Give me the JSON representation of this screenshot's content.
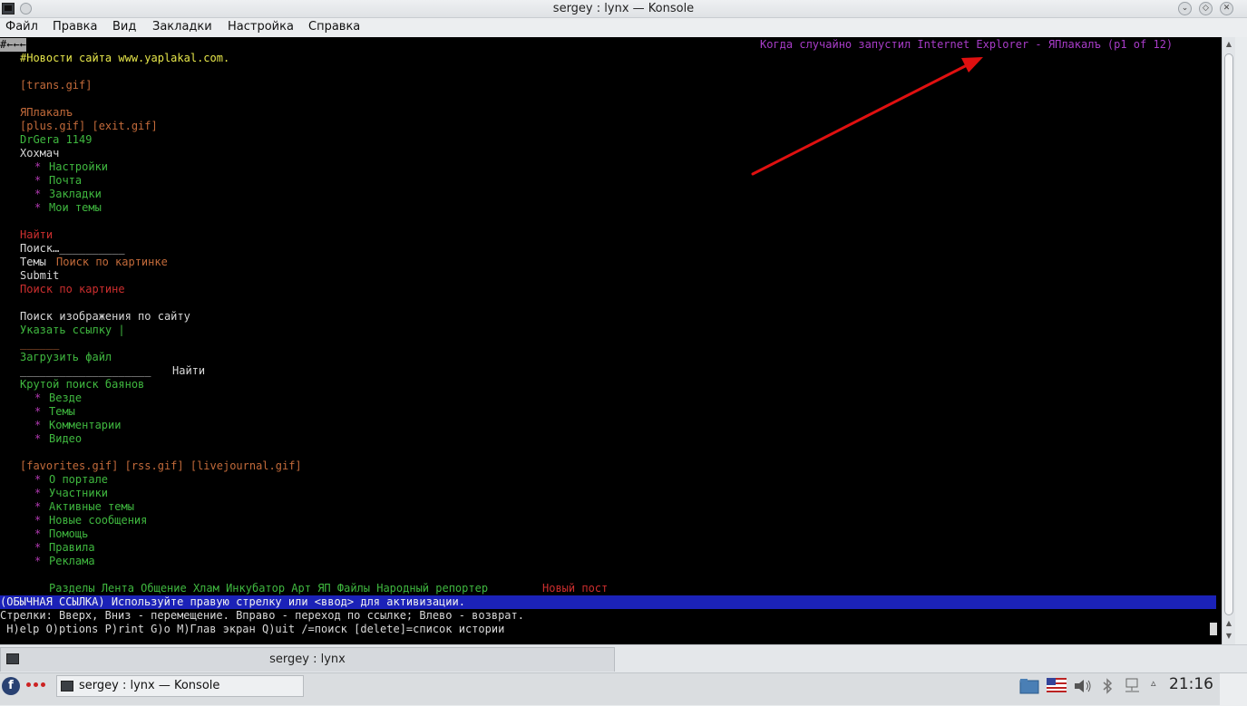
{
  "window": {
    "title": "sergey : lynx — Konsole"
  },
  "menubar": {
    "items": [
      "Файл",
      "Правка",
      "Вид",
      "Закладки",
      "Настройка",
      "Справка"
    ]
  },
  "terminal": {
    "top_left_marker": "#←←←",
    "page_title": "Когда случайно запустил Internet Explorer - ЯПлакалъ (p1 of 12)",
    "lines": {
      "l01": "#Новости сайта www.yaplakal.com.",
      "l02": "[trans.gif]",
      "l03": "ЯПлакалъ",
      "l04": "[plus.gif] [exit.gif]",
      "l05": "DrGera 1149",
      "l06": "Хохмач",
      "l07_b": "*",
      "l07": "Настройки",
      "l08_b": "*",
      "l08": "Почта",
      "l09_b": "*",
      "l09": "Закладки",
      "l10_b": "*",
      "l10": "Мои темы",
      "l11": "Найти",
      "l12": "Поиск…__________",
      "l13a": "Темы",
      "l13b": "Поиск по картинке",
      "l14": "Submit",
      "l15": "Поиск по картине",
      "l16": "Поиск изображения по сайту",
      "l17": "Указать ссылку |",
      "l18": "______",
      "l19": "Загрузить файл",
      "l20a": "____________________",
      "l20b": "Найти",
      "l21": "Крутой поиск баянов",
      "l22_b": "*",
      "l22": "Везде",
      "l23_b": "*",
      "l23": "Темы",
      "l24_b": "*",
      "l24": "Комментарии",
      "l25_b": "*",
      "l25": "Видео",
      "l26": "[favorites.gif] [rss.gif] [livejournal.gif]",
      "l27_b": "*",
      "l27": "О портале",
      "l28_b": "*",
      "l28": "Участники",
      "l29_b": "*",
      "l29": "Активные темы",
      "l30_b": "*",
      "l30": "Новые сообщения",
      "l31_b": "*",
      "l31": "Помощь",
      "l32_b": "*",
      "l32": "Правила",
      "l33_b": "*",
      "l33": "Реклама",
      "l34a": "Разделы Лента Общение Хлам Инкубатор Арт ЯП Файлы Народный репортер",
      "l34b": "Новый пост"
    },
    "status_line": "(ОБЫЧНАЯ ССЫЛКА) Используйте правую стрелку или <ввод> для активизации.",
    "help_line1": "Стрелки: Вверх, Вниз - перемещение. Вправо - переход по ссылке; Влево - возврат.",
    "help_line2": " H)elp O)ptions P)rint G)o M)Глав экран Q)uit /=поиск [delete]=список истории"
  },
  "tab": {
    "label": "sergey : lynx"
  },
  "taskbar": {
    "task_label": "sergey : lynx — Konsole",
    "clock": "21:16"
  },
  "colors": {
    "terminal_bg": "#000000",
    "status_bar_bg": "#1b22b8",
    "link_green": "#3fb83f",
    "bullet_magenta": "#b23ab2",
    "title_purple": "#a83cc8",
    "annotation_arrow": "#e01010"
  }
}
